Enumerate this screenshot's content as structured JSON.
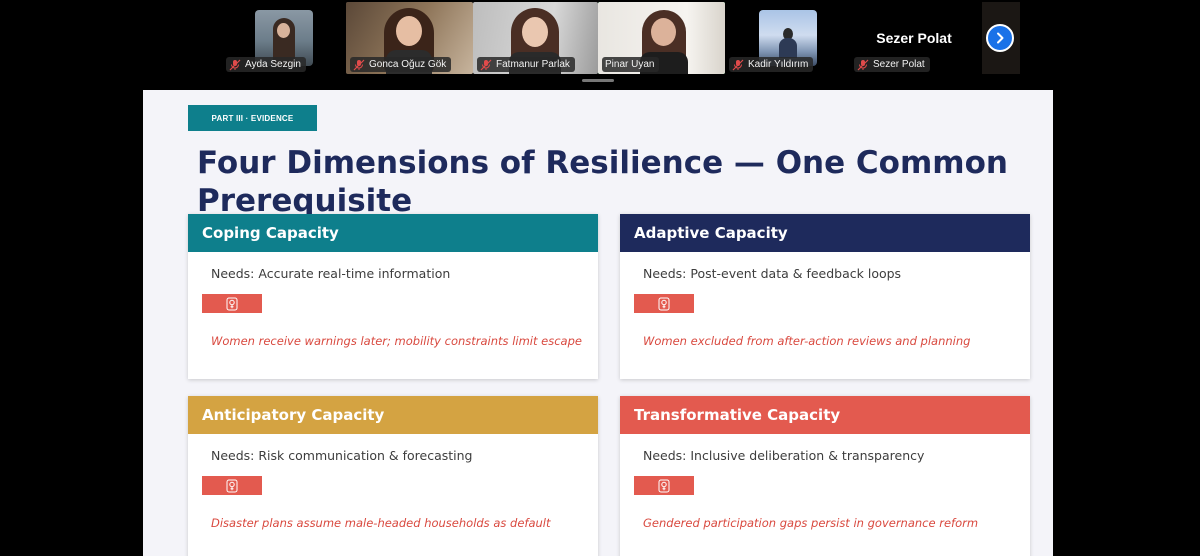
{
  "participants": [
    {
      "name": "Ayda Sezgin",
      "kind": "thumb",
      "scene": "sea",
      "muted": true
    },
    {
      "name": "Gonca Oğuz Gök",
      "kind": "video",
      "scene": "room-warm",
      "muted": true
    },
    {
      "name": "Fatmanur Parlak",
      "kind": "video",
      "scene": "room-grey",
      "muted": true
    },
    {
      "name": "Pinar Uyan",
      "kind": "video",
      "scene": "room-light",
      "muted": false,
      "active": true
    },
    {
      "name": "Kadir Yıldırım",
      "kind": "thumb",
      "scene": "sky",
      "muted": true
    },
    {
      "name": "Sezer Polat",
      "kind": "name-only",
      "muted": true,
      "display_name": "Sezer Polat"
    }
  ],
  "strip": {
    "next_icon": "chevron-right-icon"
  },
  "slide": {
    "part_tag": "PART III · EVIDENCE",
    "title": "Four Dimensions of Resilience — One Common Prerequisite",
    "cards": [
      {
        "title": "Coping Capacity",
        "color": "#0e7f8c",
        "need": "Needs: Accurate real-time information",
        "gap": "Women receive warnings later; mobility constraints limit escape",
        "icon": "venus-icon"
      },
      {
        "title": "Adaptive Capacity",
        "color": "#1e2a5c",
        "need": "Needs: Post-event data & feedback loops",
        "gap": "Women excluded from after-action reviews and planning",
        "icon": "venus-icon"
      },
      {
        "title": "Anticipatory Capacity",
        "color": "#d4a342",
        "need": "Needs: Risk communication & forecasting",
        "gap": "Disaster plans assume male-headed households as default",
        "icon": "venus-icon"
      },
      {
        "title": "Transformative Capacity",
        "color": "#e35a4f",
        "need": "Needs: Inclusive deliberation & transparency",
        "gap": "Gendered participation gaps persist in governance reform",
        "icon": "venus-icon"
      }
    ]
  }
}
